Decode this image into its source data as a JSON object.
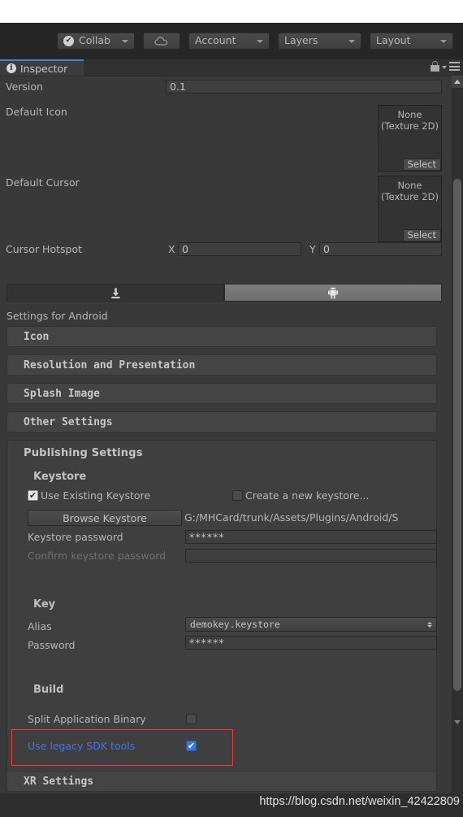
{
  "toolbar": {
    "collab_label": "Collab",
    "collab_check_glyph": "✔",
    "cloud_icon": "cloud-icon",
    "account_label": "Account",
    "layers_label": "Layers",
    "layout_label": "Layout"
  },
  "inspector": {
    "tab_label": "Inspector",
    "tab_icon": "info-icon",
    "lock_icon": "lock-icon",
    "menu_icon": "hamburger-menu-icon"
  },
  "properties": {
    "version": {
      "label": "Version",
      "value": "0.1"
    },
    "default_icon": {
      "label": "Default Icon",
      "value_line1": "None",
      "value_line2": "(Texture 2D)",
      "select_label": "Select"
    },
    "default_cursor": {
      "label": "Default Cursor",
      "value_line1": "None",
      "value_line2": "(Texture 2D)",
      "select_label": "Select"
    },
    "cursor_hotspot": {
      "label": "Cursor Hotspot",
      "x_label": "X",
      "x_value": "0",
      "y_label": "Y",
      "y_value": "0"
    }
  },
  "platform_tabs": [
    {
      "name": "standalone",
      "icon": "download-icon",
      "active": false
    },
    {
      "name": "android",
      "icon": "android-robot-icon",
      "active": true
    }
  ],
  "platform": {
    "settings_header": "Settings for Android"
  },
  "sections": [
    {
      "label": "Icon"
    },
    {
      "label": "Resolution and Presentation"
    },
    {
      "label": "Splash Image"
    },
    {
      "label": "Other Settings"
    },
    {
      "label": "XR Settings"
    }
  ],
  "publishing": {
    "header": "Publishing Settings",
    "keystore": {
      "header": "Keystore",
      "use_existing_label": "Use Existing Keystore",
      "use_existing_checked": true,
      "create_new_label": "Create a new keystore...",
      "create_new_checked": false,
      "browse_button_label": "Browse Keystore",
      "path_value": "G:/MHCard/trunk/Assets/Plugins/Android/S",
      "password_label": "Keystore password",
      "password_value": "******",
      "confirm_label": "Confirm keystore password",
      "confirm_value": ""
    },
    "key": {
      "header": "Key",
      "alias_label": "Alias",
      "alias_value": "demokey.keystore",
      "password_label": "Password",
      "password_value": "******"
    },
    "build": {
      "header": "Build",
      "split_binary_label": "Split Application Binary",
      "split_binary_checked": false,
      "legacy_sdk_label": "Use legacy SDK tools",
      "legacy_sdk_checked": true,
      "highlight_color": "#ec3b3b",
      "highlight_text_color": "#4772e6"
    }
  },
  "footer": {
    "watermark": "https://blog.csdn.net/weixin_42422809"
  }
}
